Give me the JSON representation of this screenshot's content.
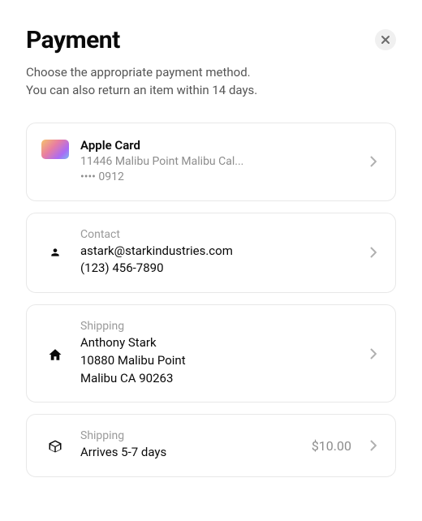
{
  "header": {
    "title": "Payment",
    "subtitle_line1": "Choose the appropriate payment method.",
    "subtitle_line2": "You can also return an item within 14 days."
  },
  "payment_method": {
    "name": "Apple Card",
    "address": "11446 Malibu Point Malibu Cal...",
    "last_digits": "•••• 0912"
  },
  "contact": {
    "label": "Contact",
    "email": "astark@starkindustries.com",
    "phone": "(123) 456-7890"
  },
  "shipping_address": {
    "label": "Shipping",
    "name": "Anthony Stark",
    "line1": "10880 Malibu Point",
    "line2": "Malibu CA 90263"
  },
  "shipping_method": {
    "label": "Shipping",
    "eta": "Arrives 5-7 days",
    "price": "$10.00"
  }
}
